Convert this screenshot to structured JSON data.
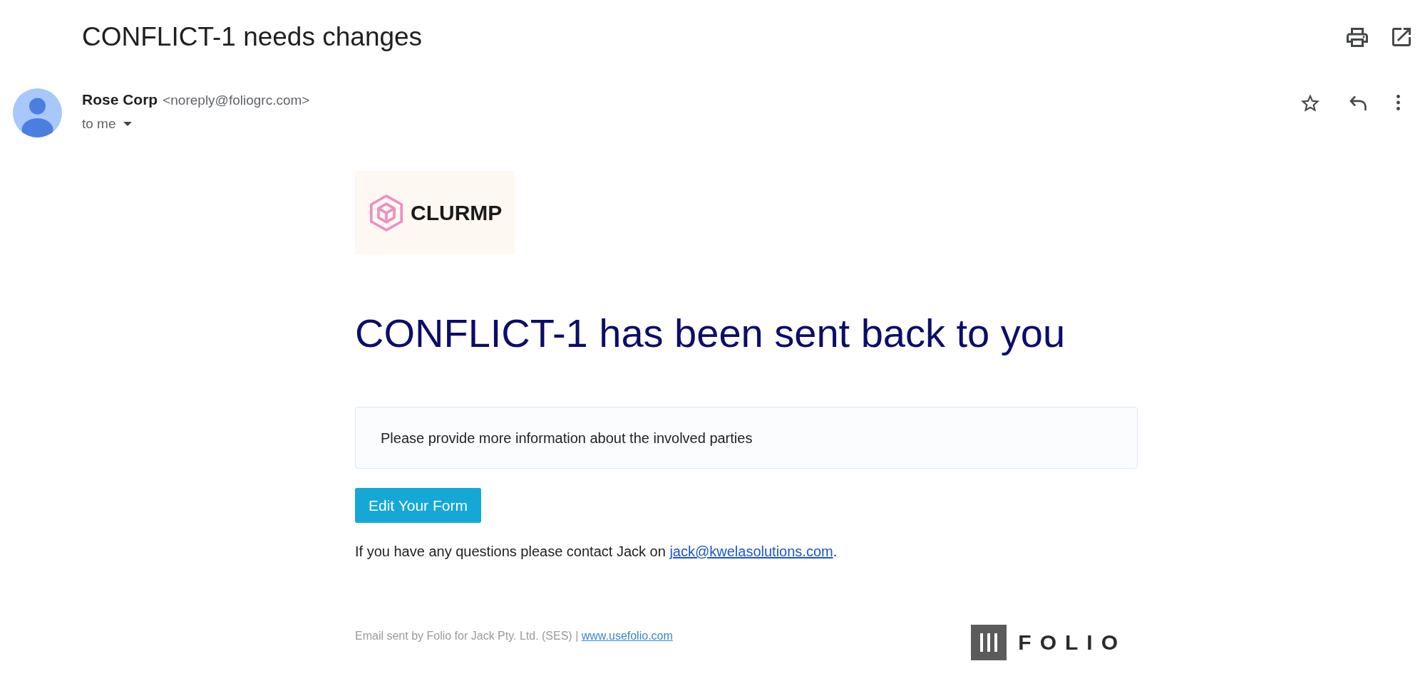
{
  "subject": "CONFLICT-1 needs changes",
  "sender": {
    "name": "Rose Corp",
    "address": "<noreply@foliogrc.com>",
    "recipient": "to me"
  },
  "body": {
    "logo_text": "CLURMP",
    "heading": "CONFLICT-1 has been sent back to you",
    "note": "Please provide more information about the involved parties",
    "button": "Edit Your Form",
    "contact": {
      "text": "If you have any questions please contact Jack on",
      "link": "jack@kwelasolutions.com",
      "end": "."
    }
  },
  "footer": {
    "text": "Email sent by Folio for Jack Pty. Ltd. (SES) |",
    "link": "www.usefolio.com",
    "logo_text": "FOLIO"
  }
}
